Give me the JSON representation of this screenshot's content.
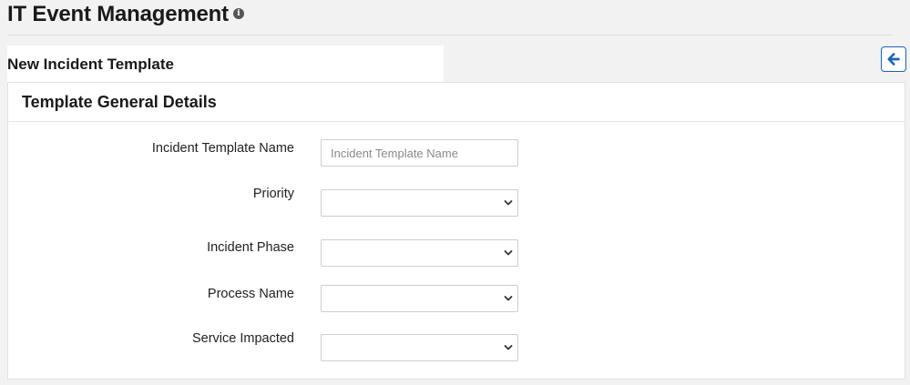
{
  "header": {
    "title": "IT Event Management",
    "info_icon": "info-icon"
  },
  "subheader": {
    "title": "New Incident Template"
  },
  "toolbar": {
    "back_icon": "arrow-left-icon",
    "back_color": "#1565c0"
  },
  "panel": {
    "title": "Template General Details",
    "fields": {
      "template_name": {
        "label": "Incident Template Name",
        "value": "",
        "placeholder": "Incident Template Name"
      },
      "priority": {
        "label": "Priority",
        "value": ""
      },
      "incident_phase": {
        "label": "Incident Phase",
        "value": ""
      },
      "process_name": {
        "label": "Process Name",
        "value": ""
      },
      "service_impacted": {
        "label": "Service Impacted",
        "value": ""
      }
    }
  }
}
